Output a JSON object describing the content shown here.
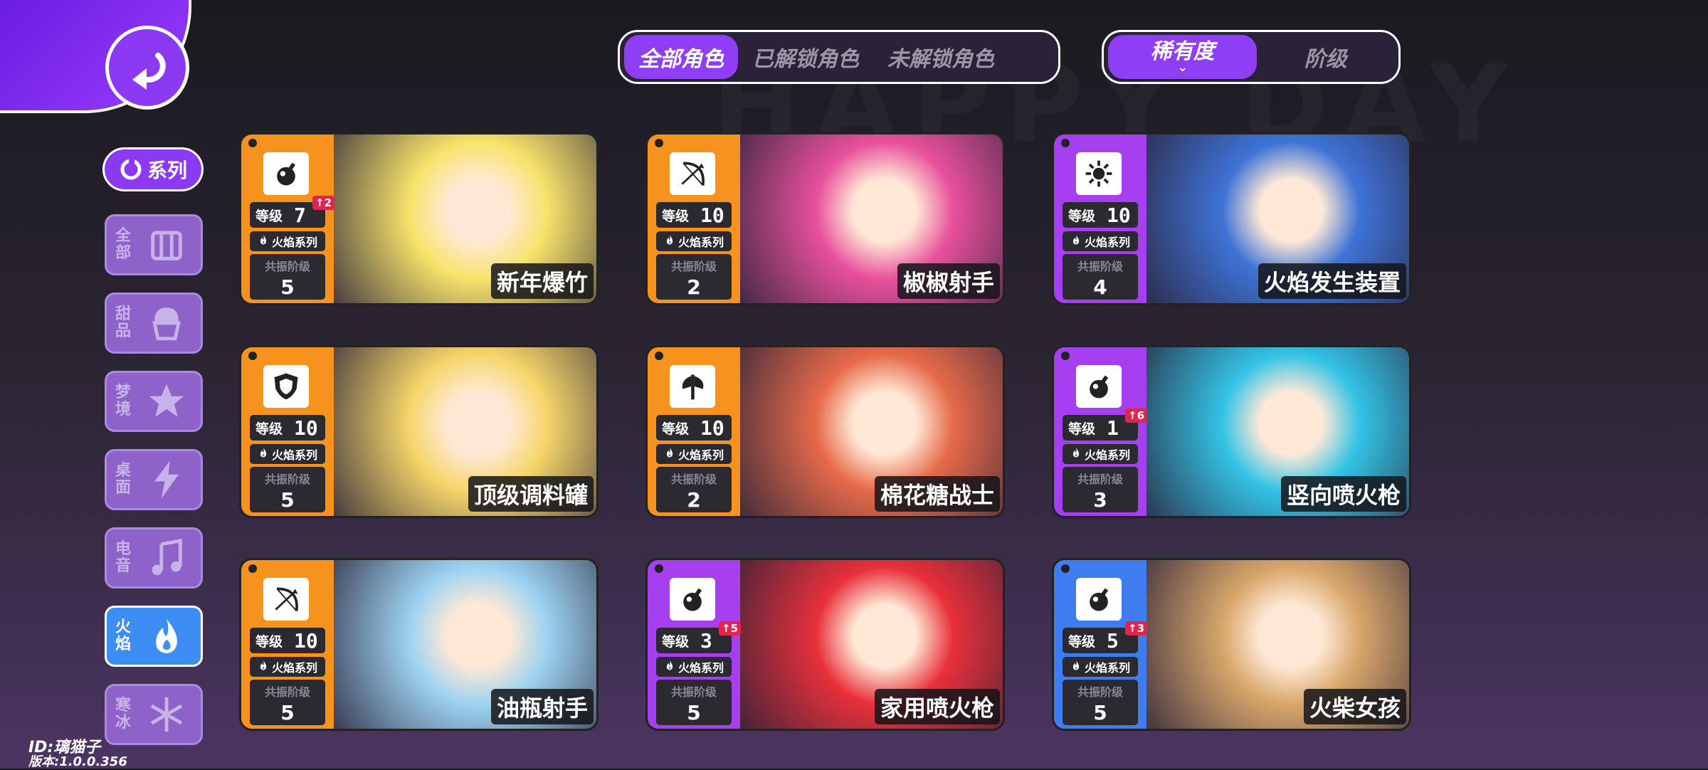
{
  "tabs": {
    "character_filter": [
      "全部角色",
      "已解锁角色",
      "未解锁角色"
    ],
    "active_filter_index": 0,
    "sort": [
      "稀有度",
      "阶级"
    ],
    "active_sort_index": 0
  },
  "sidebar": {
    "series_label": "系列",
    "items": [
      {
        "label": "全部",
        "icon": "all-icon"
      },
      {
        "label": "甜品",
        "icon": "cupcake-icon"
      },
      {
        "label": "梦境",
        "icon": "star-icon"
      },
      {
        "label": "桌面",
        "icon": "lightning-icon"
      },
      {
        "label": "电音",
        "icon": "music-note-icon"
      },
      {
        "label": "火焰",
        "icon": "flame-icon"
      },
      {
        "label": "寒冰",
        "icon": "snowflake-icon"
      }
    ],
    "active_index": 5
  },
  "card_labels": {
    "level": "等级",
    "series": "火焰系列",
    "resonance": "共振阶级"
  },
  "cards": [
    {
      "name": "新年爆竹",
      "level": "7",
      "up": "↑2",
      "resonance": "5",
      "weapon": "bomb-icon",
      "color": "#f6921e",
      "art": "#f7e36a"
    },
    {
      "name": "椒椒射手",
      "level": "10",
      "up": "",
      "resonance": "2",
      "weapon": "bow-icon",
      "color": "#f6921e",
      "art": "#e8509c"
    },
    {
      "name": "火焰发生装置",
      "level": "10",
      "up": "",
      "resonance": "4",
      "weapon": "sun-icon",
      "color": "#a53ff0",
      "art": "#3e73d6"
    },
    {
      "name": "顶级调料罐",
      "level": "10",
      "up": "",
      "resonance": "5",
      "weapon": "shield-icon",
      "color": "#f6921e",
      "art": "#f6d66a"
    },
    {
      "name": "棉花糖战士",
      "level": "10",
      "up": "",
      "resonance": "2",
      "weapon": "axe-icon",
      "color": "#f6921e",
      "art": "#e66a4a"
    },
    {
      "name": "竖向喷火枪",
      "level": "1",
      "up": "↑6",
      "resonance": "3",
      "weapon": "bomb-icon",
      "color": "#a53ff0",
      "art": "#33c3e6"
    },
    {
      "name": "油瓶射手",
      "level": "10",
      "up": "",
      "resonance": "5",
      "weapon": "bow-icon",
      "color": "#f6921e",
      "art": "#9cd3f1"
    },
    {
      "name": "家用喷火枪",
      "level": "3",
      "up": "↑5",
      "resonance": "5",
      "weapon": "bomb-icon",
      "color": "#a53ff0",
      "art": "#e8303a"
    },
    {
      "name": "火柴女孩",
      "level": "5",
      "up": "↑3",
      "resonance": "5",
      "weapon": "bomb-icon",
      "color": "#3e7cf0",
      "art": "#d8a66a"
    }
  ],
  "footer": {
    "id": "ID:璃猫子",
    "version": "版本:1.0.0.356"
  }
}
